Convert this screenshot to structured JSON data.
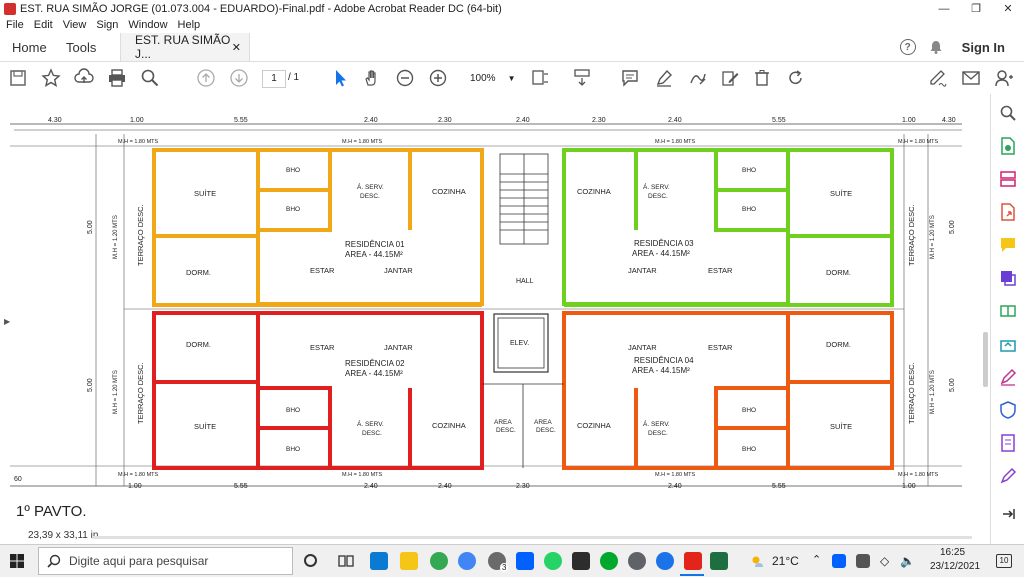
{
  "window": {
    "title": "EST. RUA SIMÃO JORGE (01.073.004 - EDUARDO)-Final.pdf - Adobe Acrobat Reader DC (64-bit)"
  },
  "menu": [
    "File",
    "Edit",
    "View",
    "Sign",
    "Window",
    "Help"
  ],
  "tabs": {
    "home": "Home",
    "tools": "Tools",
    "document": "EST. RUA SIMÃO J...",
    "signin": "Sign In"
  },
  "toolbar": {
    "page_current": "1",
    "page_total": "/ 1",
    "zoom": "100%"
  },
  "plan": {
    "top_dims": [
      "4.30",
      "1.00",
      "5.55",
      "2.40",
      "2.30",
      "2.40",
      "2.30",
      "2.40",
      "5.55",
      "1.00",
      "4.30"
    ],
    "bottom_dims": [
      "1.00",
      "5.55",
      "2.40",
      "2.40",
      "2.30",
      "2.40",
      "5.55",
      "1.00"
    ],
    "mh_top": [
      "M.H = 1.80 MTS",
      "M.H = 1.80 MTS",
      "M.H = 1.80 MTS",
      "M.H = 1.80 MTS"
    ],
    "mh_side": "M.H = 1.20 MTS",
    "side_dim": "5.00",
    "terraco": "TERRAÇO DESC.",
    "res1": {
      "name": "RESIDÊNCIA 01",
      "area": "AREA - 44.15M²"
    },
    "res2": {
      "name": "RESIDÊNCIA 02",
      "area": "AREA - 44.15M²"
    },
    "res3": {
      "name": "RESIDÊNCIA 03",
      "area": "AREA - 44.15M²"
    },
    "res4": {
      "name": "RESIDÊNCIA 04",
      "area": "AREA - 44.15M²"
    },
    "rooms": {
      "suite": "SUÍTE",
      "bho": "BHO",
      "aserv": "Á. SERV.",
      "desc": "DESC.",
      "cozinha": "COZINHA",
      "dorm": "DORM.",
      "estar": "ESTAR",
      "jantar": "JANTAR",
      "hall": "HALL",
      "elev": "ELEV.",
      "area": "AREA",
      "area_desc": "DESC."
    },
    "floor_label": "1º PAVTO.",
    "left_cut": "60"
  },
  "status": {
    "page_size": "23,39 x 33,11 in"
  },
  "taskbar": {
    "search_placeholder": "Digite aqui para pesquisar",
    "weather": "21°C",
    "time": "16:25",
    "date": "23/12/2021",
    "badge": "3",
    "notif": "10"
  },
  "colors": {
    "res1": "#f0a818",
    "res2": "#e02020",
    "res3": "#70d020",
    "res4": "#ee5a14",
    "accent": "#1473e6"
  }
}
